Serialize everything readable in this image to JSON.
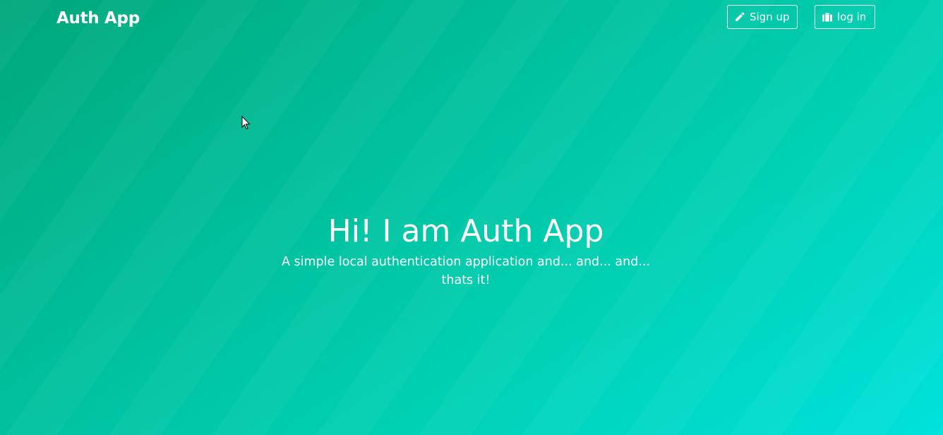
{
  "navbar": {
    "brand": "Auth App",
    "signup_label": "Sign up",
    "signup_icon": "pencil-icon",
    "login_label": "log in",
    "login_icon": "briefcase-icon"
  },
  "hero": {
    "title": "Hi! I am Auth App",
    "subtitle": "A simple local authentication application and... and... and... thats it!"
  },
  "colors": {
    "gradient_start": "#00a77a",
    "gradient_end": "#00e2dc",
    "text": "#ffffff"
  }
}
